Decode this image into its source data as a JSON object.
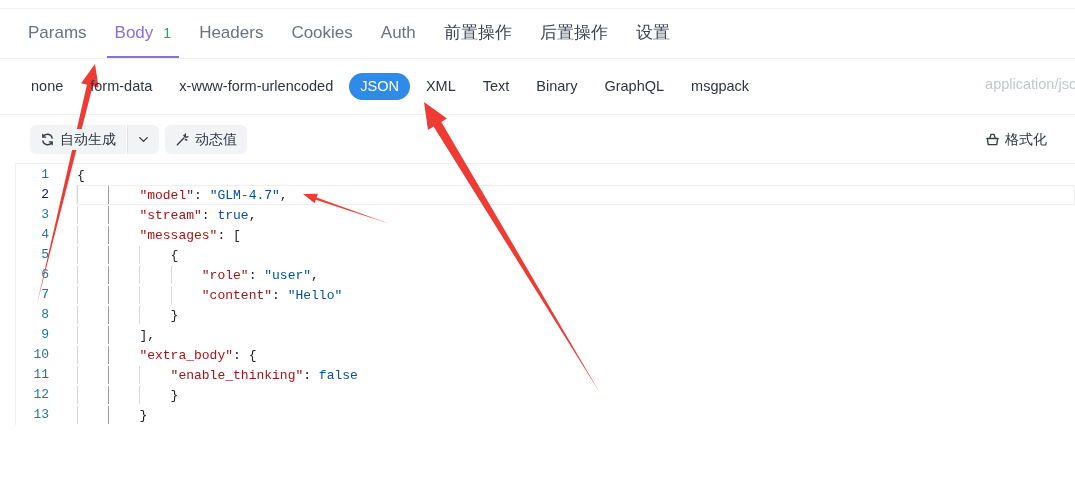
{
  "tabs": [
    {
      "label": "Params",
      "selected": false
    },
    {
      "label": "Body",
      "badge": "1",
      "selected": true
    },
    {
      "label": "Headers",
      "selected": false
    },
    {
      "label": "Cookies",
      "selected": false
    },
    {
      "label": "Auth",
      "selected": false
    },
    {
      "label": "前置操作",
      "selected": false
    },
    {
      "label": "后置操作",
      "selected": false
    },
    {
      "label": "设置",
      "selected": false
    }
  ],
  "body_types": [
    {
      "label": "none",
      "selected": false
    },
    {
      "label": "form-data",
      "selected": false
    },
    {
      "label": "x-www-form-urlencoded",
      "selected": false
    },
    {
      "label": "JSON",
      "selected": true
    },
    {
      "label": "XML",
      "selected": false
    },
    {
      "label": "Text",
      "selected": false
    },
    {
      "label": "Binary",
      "selected": false
    },
    {
      "label": "GraphQL",
      "selected": false
    },
    {
      "label": "msgpack",
      "selected": false
    }
  ],
  "content_type": "application/jso",
  "toolbar": {
    "generate_button": "自动生成",
    "dynamic_value_button": "动态值",
    "format_button": "格式化"
  },
  "editor": {
    "lines": [
      {
        "number": "1",
        "current": false,
        "tokens": [
          {
            "kind": "punct",
            "text": "{"
          }
        ]
      },
      {
        "number": "2",
        "current": true,
        "tokens": [
          {
            "kind": "key",
            "text": "        \"model\""
          },
          {
            "kind": "punct",
            "text": ": "
          },
          {
            "kind": "string",
            "text": "\"GLM-4.7\""
          },
          {
            "kind": "punct",
            "text": ","
          }
        ]
      },
      {
        "number": "3",
        "current": false,
        "tokens": [
          {
            "kind": "key",
            "text": "        \"stream\""
          },
          {
            "kind": "punct",
            "text": ": "
          },
          {
            "kind": "literal",
            "text": "true"
          },
          {
            "kind": "punct",
            "text": ","
          }
        ]
      },
      {
        "number": "4",
        "current": false,
        "tokens": [
          {
            "kind": "key",
            "text": "        \"messages\""
          },
          {
            "kind": "punct",
            "text": ": ["
          }
        ]
      },
      {
        "number": "5",
        "current": false,
        "tokens": [
          {
            "kind": "punct",
            "text": "            {"
          }
        ]
      },
      {
        "number": "6",
        "current": false,
        "tokens": [
          {
            "kind": "key",
            "text": "                \"role\""
          },
          {
            "kind": "punct",
            "text": ": "
          },
          {
            "kind": "string",
            "text": "\"user\""
          },
          {
            "kind": "punct",
            "text": ","
          }
        ]
      },
      {
        "number": "7",
        "current": false,
        "tokens": [
          {
            "kind": "key",
            "text": "                \"content\""
          },
          {
            "kind": "punct",
            "text": ": "
          },
          {
            "kind": "string",
            "text": "\"Hello\""
          }
        ]
      },
      {
        "number": "8",
        "current": false,
        "tokens": [
          {
            "kind": "punct",
            "text": "            }"
          }
        ]
      },
      {
        "number": "9",
        "current": false,
        "tokens": [
          {
            "kind": "punct",
            "text": "        ],"
          }
        ]
      },
      {
        "number": "10",
        "current": false,
        "tokens": [
          {
            "kind": "key",
            "text": "        \"extra_body\""
          },
          {
            "kind": "punct",
            "text": ": {"
          }
        ]
      },
      {
        "number": "11",
        "current": false,
        "tokens": [
          {
            "kind": "key",
            "text": "            \"enable_thinking\""
          },
          {
            "kind": "punct",
            "text": ": "
          },
          {
            "kind": "literal",
            "text": "false"
          }
        ]
      },
      {
        "number": "12",
        "current": false,
        "tokens": [
          {
            "kind": "punct",
            "text": "            }"
          }
        ]
      },
      {
        "number": "13",
        "current": false,
        "tokens": [
          {
            "kind": "punct",
            "text": "        }"
          }
        ]
      }
    ]
  }
}
